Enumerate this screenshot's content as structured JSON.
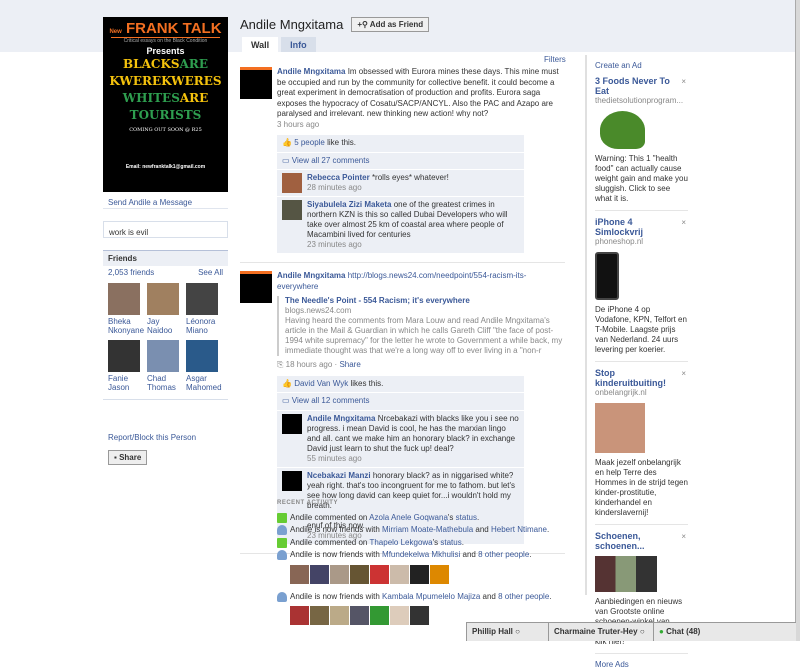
{
  "profile": {
    "name": "Andile Mngxitama",
    "add_friend": "Add as Friend",
    "send_message": "Send Andile a Message",
    "status": "work is evil",
    "report": "Report/Block this Person",
    "share": "Share"
  },
  "poster": {
    "brand_new": "New",
    "brand": "FRANK TALK",
    "tagline": "Critical essays on the Black Condition",
    "presents": "Presents",
    "line1a": "BLACKS",
    "line1b": "ARE",
    "line2": "KWEREKWERES",
    "line3a": "WHITES",
    "line3b": "ARE",
    "line4": "TOURISTS",
    "coming": "COMING OUT SOON @ R25",
    "email": "Email: newfranktalk1@gmail.com"
  },
  "friends": {
    "title": "Friends",
    "count": "2,053 friends",
    "see_all": "See All",
    "list": [
      "Bheka Nkonyane",
      "Jay Naidoo",
      "Léonora Miano",
      "Fanie Jason",
      "Chad Thomas",
      "Asgar Mahomed"
    ]
  },
  "tabs": [
    "Wall",
    "Info"
  ],
  "filters": "Filters",
  "posts": [
    {
      "author": "Andile Mngxitama",
      "text": "Im obsessed with Eurora mines these days. This mine must be occupied and run by the community for collective benefit. it could become a great experiment in democratisation of production and profits. Eurora saga exposes the hypocracy of Cosatu/SACP/ANCYL. Also the PAC and Azapo are paralysed and irrelevant. new thinking new action! why not?",
      "time": "3 hours ago",
      "likes_link": "5 people",
      "likes_suffix": " like this.",
      "view_comments": "View all 27 comments",
      "comments": [
        {
          "author": "Rebecca Pointer",
          "text": "*rolls eyes* whatever!",
          "time": "28 minutes ago"
        },
        {
          "author": "Siyabulela Zizi Maketa",
          "text": "one of the greatest crimes in northern KZN is this so called Dubai Developers who will take over almost 25 km of coastal area where people of Macambini lived for centuries",
          "time": "23 minutes ago"
        }
      ]
    },
    {
      "author": "Andile Mngxitama",
      "text": "http://blogs.news24.com/needpoint/554-racism-its-everywhere",
      "att_title": "The Needle's Point - 554 Racism; it's everywhere",
      "att_domain": "blogs.news24.com",
      "att_desc": "Having heard the comments from Mara Louw and read Andile Mngxitama's article in the Mail & Guardian in which he calls Gareth Cliff \"the face of post-1994 white supremacy\" for the letter he wrote to Government a while back, my immediate thought was that we're a long way off to ever living in a \"non-r",
      "time": "18 hours ago",
      "share": "Share",
      "likes_link": "David Van Wyk",
      "likes_suffix": " likes this.",
      "view_comments": "View all 12 comments",
      "comments": [
        {
          "author": "Andile Mngxitama",
          "text": "Nrcebakazi with blacks like you i see no progress. i mean David is cool, he has the marxian lingo and all. cant we make him an honorary black? in exchange David just learn to shut the fuck up! deal?",
          "time": "55 minutes ago"
        },
        {
          "author": "Ncebakazi Manzi",
          "text": "honorary black? as in niggarised white? yeah right. that's too incongruent for me to fathom. but let's see how long david can keep quiet for...i wouldn't hold my breath.\n\nenuf of this now.",
          "time": "23 minutes ago"
        }
      ]
    }
  ],
  "recent": {
    "title": "RECENT ACTIVITY",
    "items": [
      {
        "icon": "comment",
        "pre": "Andile commented on ",
        "l1": "Azola Anele Goqwana",
        "mid": "'s ",
        "l2": "status",
        "post": "."
      },
      {
        "icon": "friend",
        "pre": "Andile is now friends with ",
        "l1": "Mirriam Moate-Mathebula",
        "mid": " and ",
        "l2": "Hebert Ntimane",
        "post": "."
      },
      {
        "icon": "comment",
        "pre": "Andile commented on ",
        "l1": "Thapelo Lekgowa",
        "mid": "'s ",
        "l2": "status",
        "post": "."
      },
      {
        "icon": "friend",
        "pre": "Andile is now friends with ",
        "l1": "Mfundekelwa Mkhulisi",
        "mid": " and ",
        "l2": "8 other people",
        "post": "."
      },
      {
        "icon": "friend",
        "pre": "Andile is now friends with ",
        "l1": "Kambala Mpumelelo Majiza",
        "mid": " and ",
        "l2": "8 other people",
        "post": "."
      }
    ]
  },
  "ads": {
    "create": "Create an Ad",
    "more": "More Ads",
    "items": [
      {
        "title": "3 Foods Never To Eat",
        "domain": "thedietsolutionprogram...",
        "text": "Warning: This 1 \"health food\" can actually cause weight gain and make you sluggish. Click to see what it is."
      },
      {
        "title": "iPhone 4 Simlockvrij",
        "domain": "phoneshop.nl",
        "text": "De iPhone 4 op Vodafone, KPN, Telfort en T-Mobile. Laagste prijs van Nederland. 24 uurs levering per koerier."
      },
      {
        "title": "Stop kinderuitbuiting!",
        "domain": "onbelangrijk.nl",
        "text": "Maak jezelf onbelangrijk en help Terre des Hommes in de strijd tegen kinder-prostitutie, kinderhandel en kinderslavernij!"
      },
      {
        "title": "Schoenen, schoenen...",
        "domain": "",
        "text": "Aanbiedingen en nieuws van Grootste online schoenen-winkel van Nederland via Facebook, klik hier!"
      }
    ]
  },
  "chatbar": {
    "tab1": "Phillip Hall",
    "tab2": "Charmaine Truter-Hey",
    "chat": "Chat (48)"
  }
}
